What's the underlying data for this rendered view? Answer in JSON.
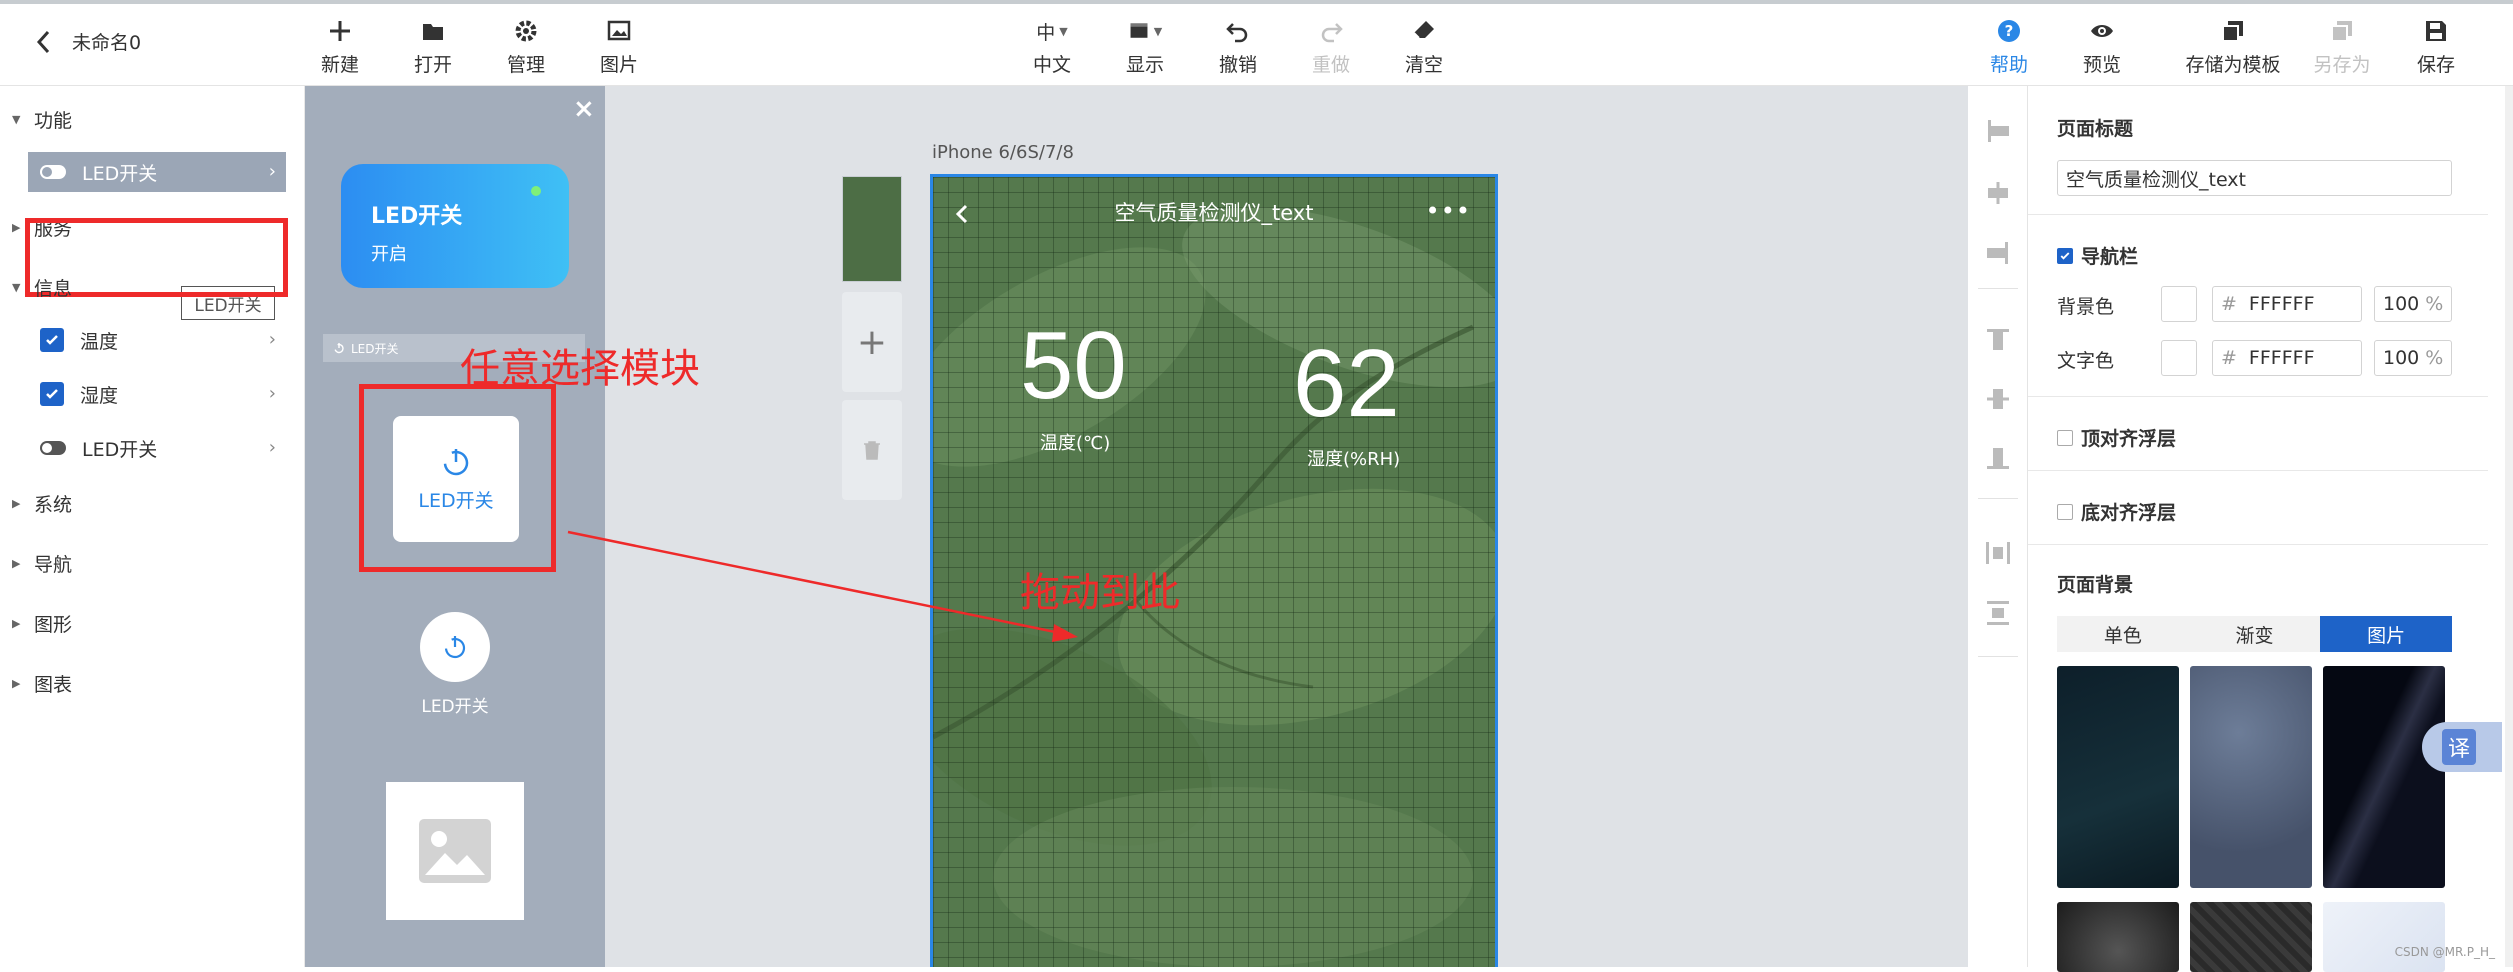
{
  "app": {
    "doc_name": "未命名0"
  },
  "toolbar": {
    "new": "新建",
    "open": "打开",
    "manage": "管理",
    "image": "图片",
    "lang_code": "中",
    "lang": "中文",
    "display": "显示",
    "undo": "撤销",
    "redo": "重做",
    "clear": "清空",
    "help": "帮助",
    "preview": "预览",
    "save_template": "存储为模板",
    "save_as": "另存为",
    "save": "保存"
  },
  "sidebar": {
    "sections": [
      "功能",
      "服务",
      "信息",
      "系统",
      "导航",
      "图形",
      "图表"
    ],
    "func_item": "LED开关",
    "tooltip": "LED开关",
    "info_items": [
      "温度",
      "湿度",
      "LED开关"
    ]
  },
  "panel": {
    "card_title": "LED开关",
    "card_state": "开启",
    "mini_label": "LED开关",
    "square_label": "LED开关",
    "circle_label": "LED开关"
  },
  "canvas": {
    "device": "iPhone 6/6S/7/8",
    "page_title": "空气质量检测仪_text",
    "temp_value": "50",
    "temp_caption": "温度(℃)",
    "hum_value": "62",
    "hum_caption": "湿度(%RH)",
    "annotation_select": "任意选择模块",
    "annotation_drag": "拖动到此"
  },
  "props": {
    "page_title_label": "页面标题",
    "page_title_value": "空气质量检测仪_text",
    "navbar_label": "导航栏",
    "bg_color_label": "背景色",
    "text_color_label": "文字色",
    "hash": "#",
    "bg_hex": "FFFFFF",
    "bg_alpha": "100",
    "text_hex": "FFFFFF",
    "text_alpha": "100",
    "percent": "%",
    "top_float_label": "顶对齐浮层",
    "bottom_float_label": "底对齐浮层",
    "page_bg_label": "页面背景",
    "tabs": [
      "单色",
      "渐变",
      "图片"
    ],
    "translate_badge": "译",
    "watermark": "CSDN @MR.P_H_"
  },
  "colors": {
    "accent": "#1e63c8",
    "help": "#2a87e6",
    "annotation": "#ee2a2a",
    "panel": "#a3adbb"
  }
}
